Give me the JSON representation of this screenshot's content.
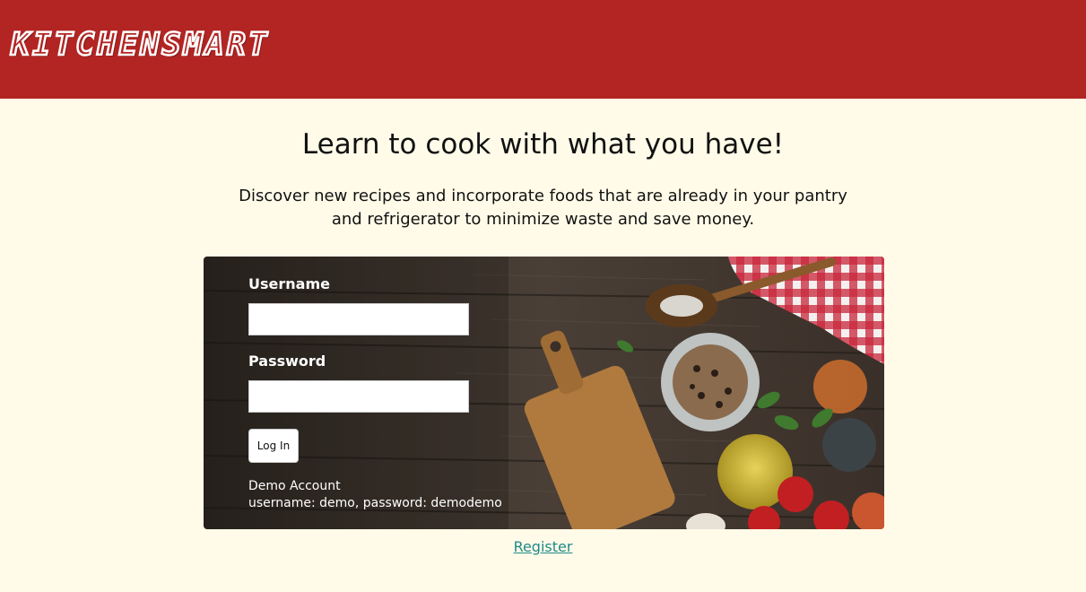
{
  "header": {
    "brand": "KITCHENSMART",
    "brand_color": "#b22523"
  },
  "main": {
    "headline": "Learn to cook with what you have!",
    "description": "Discover new recipes and incorporate foods that are already in your pantry and refrigerator to minimize waste and save money."
  },
  "login": {
    "username_label": "Username",
    "username_value": "",
    "password_label": "Password",
    "password_value": "",
    "login_button": "Log In",
    "demo_title": "Demo Account",
    "demo_credentials": "username: demo, password: demodemo"
  },
  "register_link": "Register",
  "colors": {
    "background": "#fffbe8",
    "link": "#1f8a8a"
  }
}
